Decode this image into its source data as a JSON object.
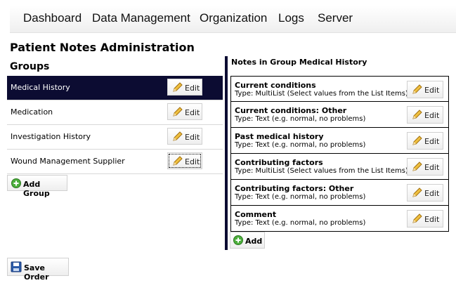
{
  "nav": {
    "items": [
      {
        "label": "Dashboard"
      },
      {
        "label": "Data Management"
      },
      {
        "label": "Organization"
      },
      {
        "label": "Logs"
      },
      {
        "label": "Server"
      }
    ]
  },
  "page": {
    "title": "Patient Notes Administration",
    "groups_title": "Groups"
  },
  "groups": {
    "selected_index": 0,
    "items": [
      {
        "label": "Medical History",
        "edit_label": "Edit"
      },
      {
        "label": "Medication",
        "edit_label": "Edit"
      },
      {
        "label": "Investigation History",
        "edit_label": "Edit"
      },
      {
        "label": "Wound Management Supplier",
        "edit_label": "Edit"
      }
    ],
    "add_label": "Add Group"
  },
  "notes": {
    "title": "Notes in Group Medical History",
    "items": [
      {
        "name": "Current conditions",
        "type": "Type: MultiList (Select values from the List Items)",
        "edit_label": "Edit"
      },
      {
        "name": "Current conditions: Other",
        "type": "Type: Text (e.g. normal, no problems)",
        "edit_label": "Edit"
      },
      {
        "name": "Past medical history",
        "type": "Type: Text (e.g. normal, no problems)",
        "edit_label": "Edit"
      },
      {
        "name": "Contributing factors",
        "type": "Type: MultiList (Select values from the List Items)",
        "edit_label": "Edit"
      },
      {
        "name": "Contributing factors: Other",
        "type": "Type: Text (e.g. normal, no problems)",
        "edit_label": "Edit"
      },
      {
        "name": "Comment",
        "type": "Type: Text (e.g. normal, no problems)",
        "edit_label": "Edit"
      }
    ],
    "add_label": "Add"
  },
  "actions": {
    "save_order_label": "Save Order"
  },
  "colors": {
    "selected_row": "#0c0c32",
    "add_icon": "#4caf3c",
    "save_icon": "#2a5aa8",
    "pencil": "#e0a020"
  },
  "icons": {
    "edit": "pencil-icon",
    "add": "plus-circle-icon",
    "save": "floppy-disk-icon"
  }
}
